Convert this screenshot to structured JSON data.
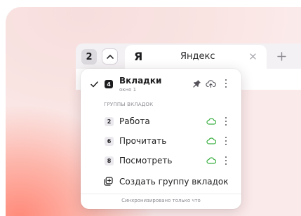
{
  "tabbar": {
    "tab_count": "2",
    "active_tab": {
      "logo": "Я",
      "title": "Яндекс"
    }
  },
  "menu": {
    "current_window": {
      "title": "Вкладки",
      "subtitle": "окно 1",
      "tab_count": "4"
    },
    "section_title": "ГРУППЫ ВКЛАДОК",
    "groups": [
      {
        "count": "2",
        "name": "Работа"
      },
      {
        "count": "6",
        "name": "Прочитать"
      },
      {
        "count": "8",
        "name": "Посмотреть"
      }
    ],
    "create_group_label": "Создать группу вкладок",
    "sync_status": "Синхронизировано только что"
  },
  "colors": {
    "sync_cloud": "#3cb043",
    "accent_bg": "#ff8a7a"
  },
  "icons": [
    "check-icon",
    "pin-icon",
    "cloud-upload-icon",
    "cloud-icon",
    "kebab-icon",
    "new-group-icon",
    "chevron-up-icon",
    "close-icon",
    "plus-icon"
  ]
}
